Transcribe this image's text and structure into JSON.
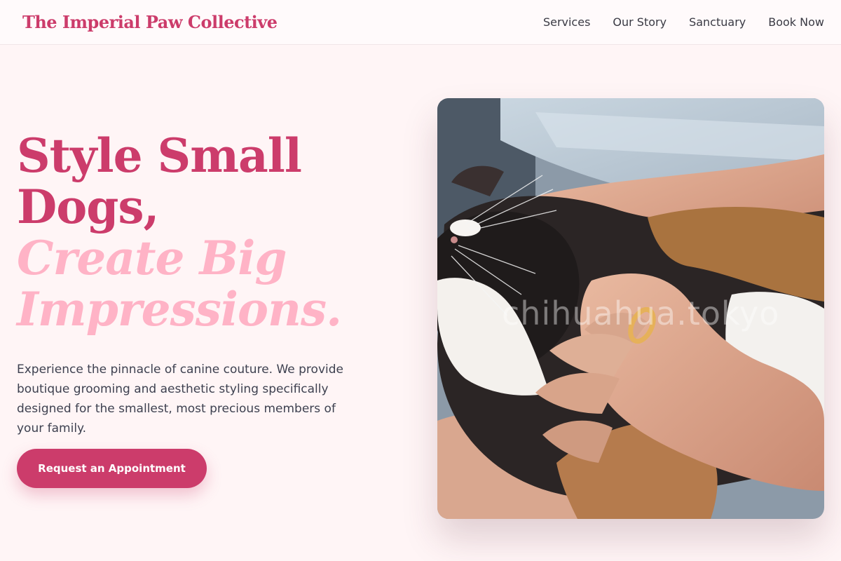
{
  "brand": {
    "name": "The Imperial Paw Collective",
    "color": "#cc3c6b"
  },
  "nav": {
    "items": [
      {
        "label": "Services"
      },
      {
        "label": "Our Story"
      },
      {
        "label": "Sanctuary"
      },
      {
        "label": "Book Now"
      }
    ]
  },
  "hero": {
    "headline_line1": "Style Small",
    "headline_line2": "Dogs,",
    "headline_line3": "Create Big",
    "headline_line4": "Impressions.",
    "description": "Experience the pinnacle of canine couture. We provide boutique grooming and aesthetic styling specifically designed for the smallest, most precious members of your family.",
    "cta_label": "Request an Appointment",
    "image_watermark": "chihuahua.tokyo",
    "image_subject": "calico cat being petted by a hand wearing a gold ring"
  },
  "colors": {
    "accent": "#cc3c6b",
    "accent_light": "#ffb3c6",
    "background": "#fff5f6",
    "text": "#3e4150"
  }
}
